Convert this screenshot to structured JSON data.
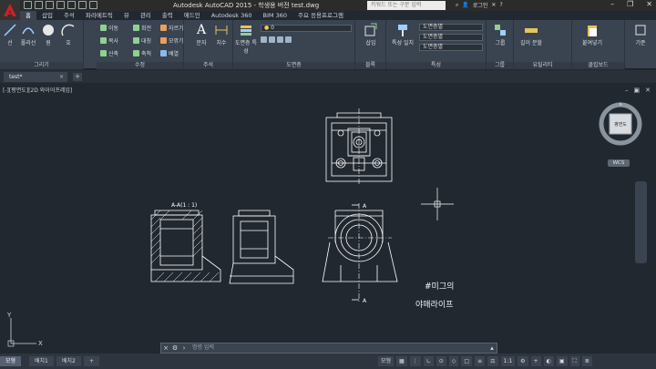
{
  "title_bar": {
    "title": "Autodesk AutoCAD 2015 - 학생용 버전    test.dwg",
    "search_placeholder": "키워드 또는 구문 입력",
    "signin_label": "로그인"
  },
  "menu_tabs": [
    "홈",
    "삽입",
    "주석",
    "파라메트릭",
    "뷰",
    "관리",
    "출력",
    "애드인",
    "Autodesk 360",
    "BIM 360",
    "주요 응용프로그램"
  ],
  "ribbon": {
    "panels": [
      {
        "title": "그리기",
        "items": [
          "선",
          "폴리선",
          "원",
          "호"
        ]
      },
      {
        "title": "수정",
        "items": [
          "이동",
          "회전",
          "자르기",
          "복사",
          "대칭",
          "모깎기",
          "신축",
          "축척",
          "배열"
        ]
      },
      {
        "title": "주석",
        "items": [
          "문자",
          "치수"
        ]
      },
      {
        "title": "도면층",
        "items": [
          "도면층 특성"
        ]
      },
      {
        "title": "블록",
        "items": [
          "삽입"
        ]
      },
      {
        "title": "특성",
        "items": [
          "특성 일치",
          "도면층별",
          "도면층별",
          "도면층별"
        ]
      },
      {
        "title": "그룹",
        "items": [
          "그룹"
        ]
      },
      {
        "title": "유틸리티",
        "items": [
          "길이 분할"
        ]
      },
      {
        "title": "클립보드",
        "items": [
          "붙여넣기"
        ]
      },
      {
        "title": "",
        "items": [
          "기준"
        ]
      }
    ],
    "layer_current": "0"
  },
  "file_tab": {
    "label": "test*"
  },
  "viewport": {
    "label": "[-][평면도][2D 와이어프레임]",
    "section_label": "A-A(1 : 1)",
    "marker_a": "A"
  },
  "viewcube": {
    "face": "평면도",
    "wcs": "WCS"
  },
  "ucs": {
    "x": "X",
    "y": "Y"
  },
  "handwriting": [
    "#미그의",
    "야매라이프"
  ],
  "command_line": {
    "placeholder": "명령 입력"
  },
  "layout_tabs": [
    "모형",
    "배치1",
    "배치2"
  ],
  "status": {
    "model_label": "모형",
    "scale": "1:1"
  },
  "colors": {
    "background": "#212830",
    "ribbon": "#3a4350",
    "drawing_lines": "#ffffff",
    "autocad_red": "#d21e24"
  }
}
